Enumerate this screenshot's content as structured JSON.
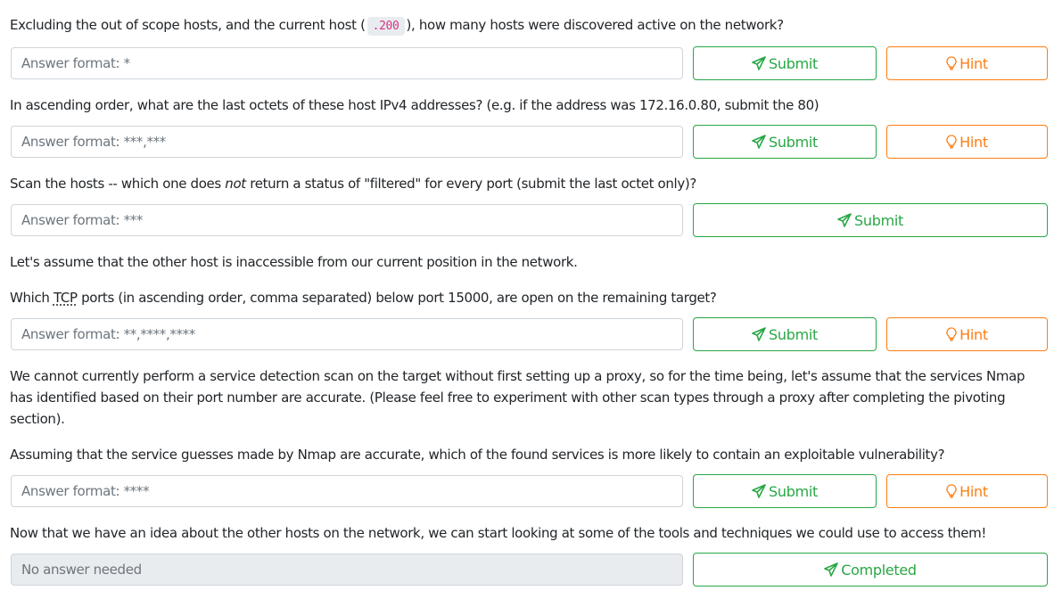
{
  "questions": [
    {
      "text_before": "Excluding the out of scope hosts, and the current host (",
      "code": ".200",
      "text_after": "), how many hosts were discovered active on the network?",
      "placeholder": "Answer format: *",
      "submit_label": "Submit",
      "hint_label": "Hint"
    },
    {
      "text": "In ascending order, what are the last octets of these host IPv4 addresses? (e.g. if the address was 172.16.0.80, submit the 80)",
      "placeholder": "Answer format: ***,***",
      "submit_label": "Submit",
      "hint_label": "Hint"
    },
    {
      "text_before": "Scan the hosts -- which one does ",
      "emphasis": "not",
      "text_after": " return a status of \"filtered\" for every port (submit the last octet only)?",
      "placeholder": "Answer format: ***",
      "submit_label": "Submit"
    },
    {
      "intro": "Let's assume that the other host is inaccessible from our current position in the network.",
      "text_before": "Which ",
      "abbr": "TCP",
      "text_after": " ports (in ascending order, comma separated) below port 15000, are open on the remaining target?",
      "placeholder": "Answer format: **,****,****",
      "submit_label": "Submit",
      "hint_label": "Hint"
    },
    {
      "intro": "We cannot currently perform a service detection scan on the target without first setting up a proxy, so for the time being, let's assume that the services Nmap has identified based on their port number are accurate. (Please feel free to experiment with other scan types through a proxy after completing the pivoting section).",
      "text": "Assuming that the service guesses made by Nmap are accurate, which of the found services is more likely to contain an exploitable vulnerability?",
      "placeholder": "Answer format: ****",
      "submit_label": "Submit",
      "hint_label": "Hint"
    },
    {
      "text": "Now that we have an idea about the other hosts on the network, we can start looking at some of the tools and techniques we could use to access them!",
      "value": "No answer needed",
      "completed_label": "Completed"
    }
  ],
  "colors": {
    "success": "#28a745",
    "warning": "#fd7e14",
    "code": "#d63384"
  }
}
